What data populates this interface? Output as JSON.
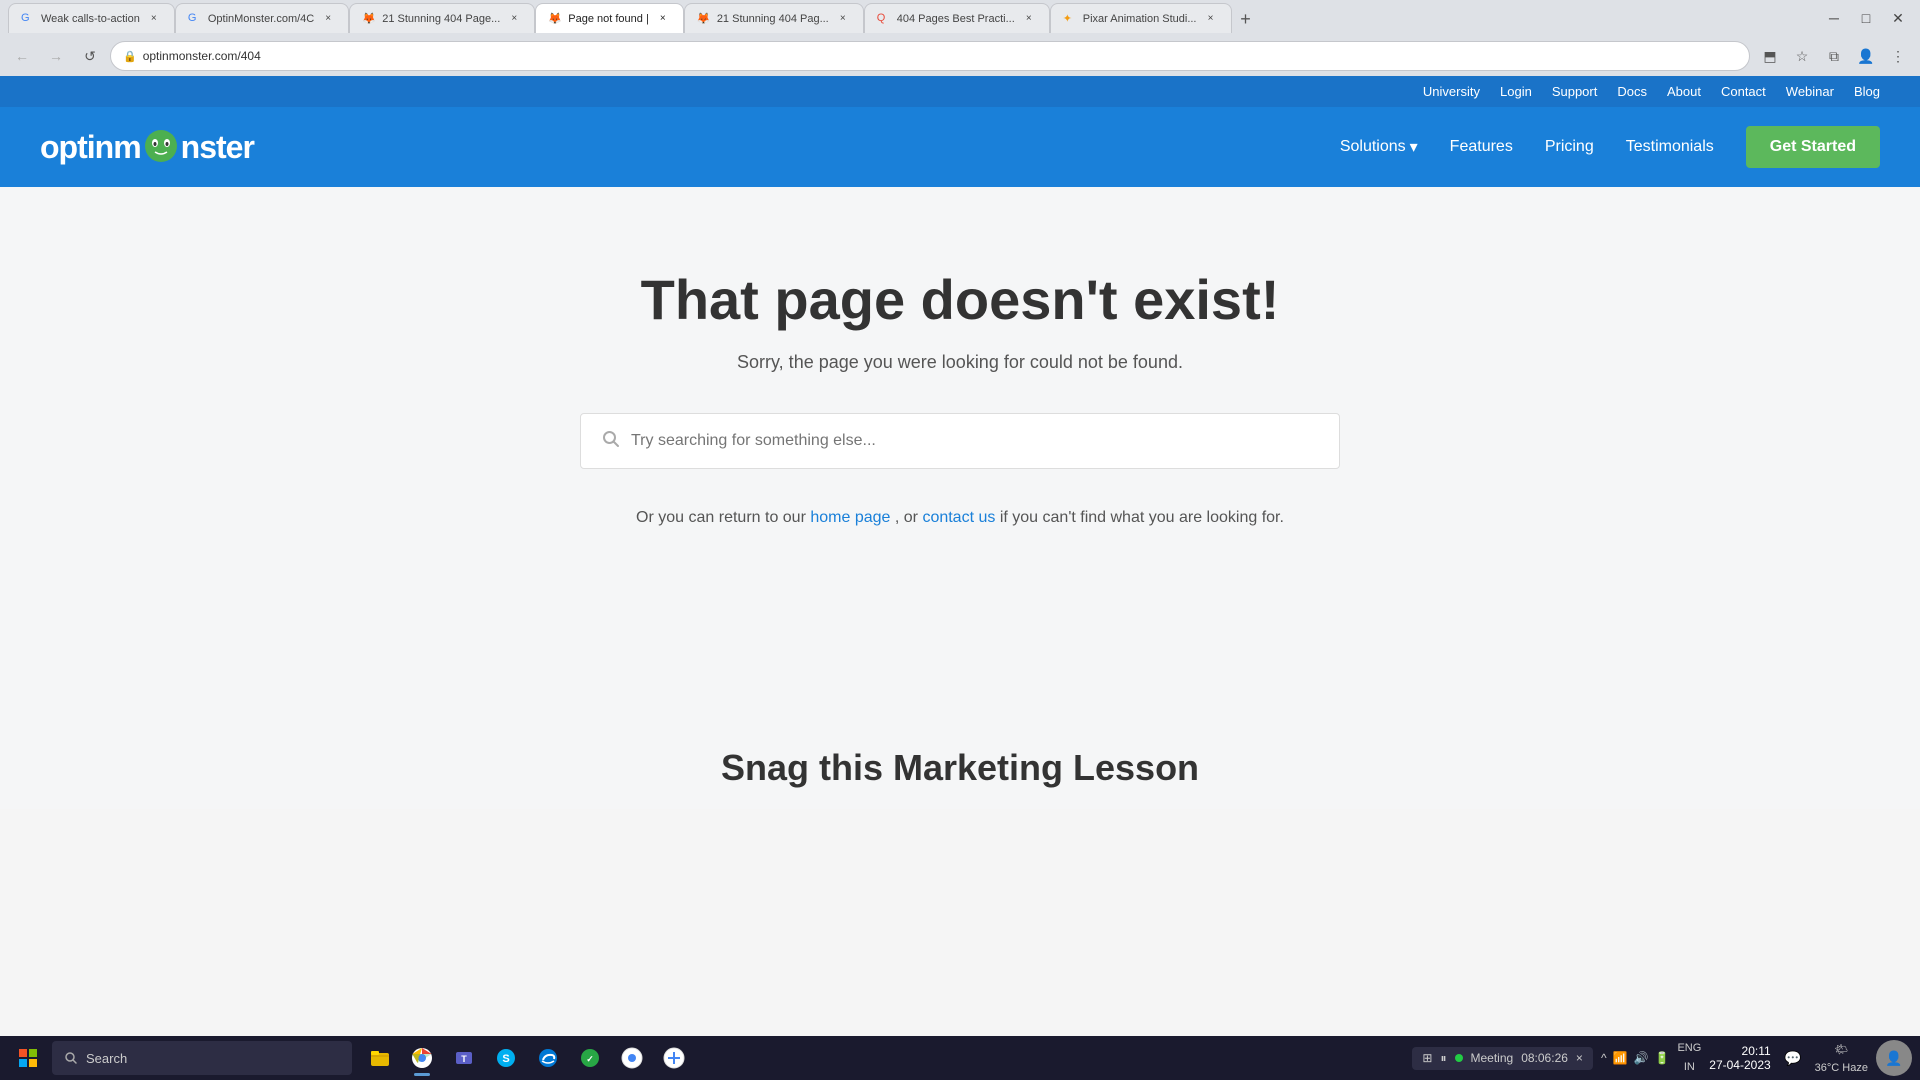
{
  "browser": {
    "url": "optinmonster.com/404",
    "tabs": [
      {
        "id": "tab1",
        "title": "Weak calls-to-action",
        "favicon": "G",
        "active": false
      },
      {
        "id": "tab2",
        "title": "OptinMonster.com/4C",
        "favicon": "G",
        "active": false
      },
      {
        "id": "tab3",
        "title": "21 Stunning 404 Page",
        "favicon": "🦊",
        "active": false
      },
      {
        "id": "tab4",
        "title": "Page not found |",
        "favicon": "🦊",
        "active": true
      },
      {
        "id": "tab5",
        "title": "21 Stunning 404 Pag...",
        "favicon": "🦊",
        "active": false
      },
      {
        "id": "tab6",
        "title": "404 Pages Best Practi...",
        "favicon": "Q",
        "active": false
      },
      {
        "id": "tab7",
        "title": "Pixar Animation Studi...",
        "favicon": "🌟",
        "active": false
      }
    ],
    "nav": {
      "back": "←",
      "forward": "→",
      "refresh": "↺",
      "home": "⌂"
    }
  },
  "topbar": {
    "links": [
      "University",
      "Login",
      "Support",
      "Docs",
      "About",
      "Contact",
      "Webinar",
      "Blog"
    ]
  },
  "mainnav": {
    "logo_text_before": "optinm",
    "logo_text_after": "nster",
    "links": [
      {
        "label": "Solutions",
        "has_dropdown": true
      },
      {
        "label": "Features",
        "has_dropdown": false
      },
      {
        "label": "Pricing",
        "has_dropdown": false
      },
      {
        "label": "Testimonials",
        "has_dropdown": false
      }
    ],
    "cta_label": "Get Started"
  },
  "content": {
    "title": "That page doesn't exist!",
    "subtitle": "Sorry, the page you were looking for could not be found.",
    "search_placeholder": "Try searching for something else...",
    "return_text_before": "Or you can return to our ",
    "home_link": "home page",
    "return_text_middle": ", or ",
    "contact_link": "contact us",
    "return_text_after": " if you can't find what you are looking for."
  },
  "bottom_teaser": {
    "heading": "Snag this Marketing Lesson"
  },
  "taskbar": {
    "search_label": "Search",
    "meeting_label": "Meeting",
    "time": "20:11",
    "date": "27-04-2023",
    "lang": "ENG\nIN",
    "weather": "36°C\nHaze",
    "close_label": "×"
  }
}
